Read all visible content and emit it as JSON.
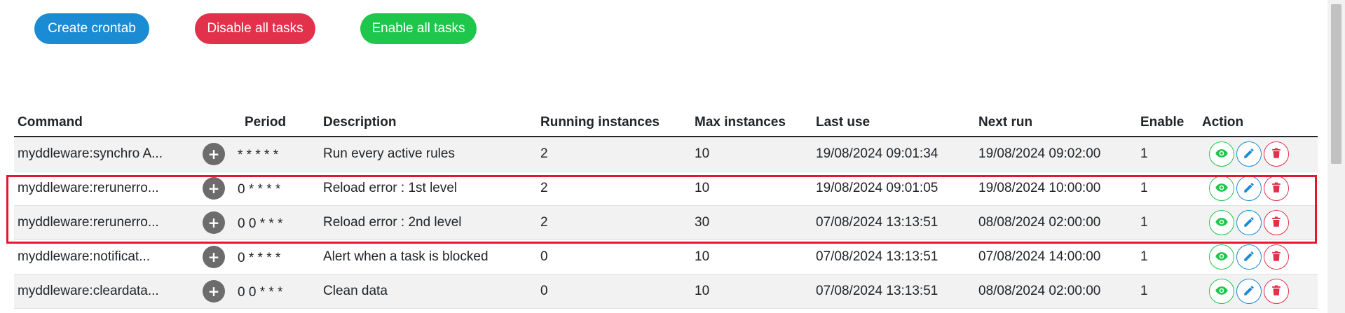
{
  "toolbar": {
    "create_label": "Create crontab",
    "disable_label": "Disable all tasks",
    "enable_label": "Enable all tasks"
  },
  "table": {
    "headers": {
      "command": "Command",
      "period": "Period",
      "description": "Description",
      "running": "Running instances",
      "max": "Max instances",
      "last_use": "Last use",
      "next_run": "Next run",
      "enable": "Enable",
      "action": "Action"
    },
    "rows": [
      {
        "command": "myddleware:synchro A...",
        "period": "* * * * *",
        "description": "Run every active rules",
        "running": "2",
        "max": "10",
        "last_use": "19/08/2024 09:01:34",
        "next_run": "19/08/2024 09:02:00",
        "enable": "1"
      },
      {
        "command": "myddleware:rerunerro...",
        "period": "0 * * * *",
        "description": "Reload error : 1st level",
        "running": "2",
        "max": "10",
        "last_use": "19/08/2024 09:01:05",
        "next_run": "19/08/2024 10:00:00",
        "enable": "1"
      },
      {
        "command": "myddleware:rerunerro...",
        "period": "0 0 * * *",
        "description": "Reload error : 2nd level",
        "running": "2",
        "max": "30",
        "last_use": "07/08/2024 13:13:51",
        "next_run": "08/08/2024 02:00:00",
        "enable": "1"
      },
      {
        "command": "myddleware:notificat...",
        "period": "0 * * * *",
        "description": "Alert when a task is blocked",
        "running": "0",
        "max": "10",
        "last_use": "07/08/2024 13:13:51",
        "next_run": "07/08/2024 14:00:00",
        "enable": "1"
      },
      {
        "command": "myddleware:cleardata...",
        "period": "0 0 * * *",
        "description": "Clean data",
        "running": "0",
        "max": "10",
        "last_use": "07/08/2024 13:13:51",
        "next_run": "08/08/2024 02:00:00",
        "enable": "1"
      }
    ]
  },
  "icons": {
    "expand": "plus-icon",
    "view": "eye-icon",
    "edit": "pencil-icon",
    "delete": "trash-icon"
  },
  "colors": {
    "primary": "#1b8bd3",
    "danger": "#e2314a",
    "success": "#1ec64b",
    "highlight": "#e3172d"
  }
}
